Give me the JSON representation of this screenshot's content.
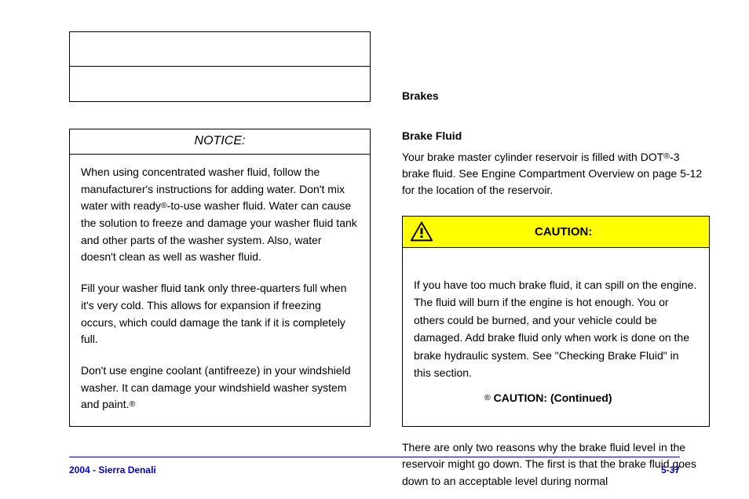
{
  "leftColumn": {
    "noticeHeader": "NOTICE:",
    "noticePara1_pre": "When using concentrated washer fluid, follow the manufacturer's instructions for adding water.\nDon't mix water with ready",
    "noticePara1_mid": "-",
    "noticePara1_post": "to",
    "noticePara1_after": "-",
    "noticePara1_rest": "use washer fluid.\nWater can cause the solution to freeze and damage your washer fluid tank and other parts of the washer system. Also, water doesn't clean as well as washer fluid.",
    "noticePara2": "Fill your washer fluid tank only three-quarters full when it's very cold. This allows for expansion if freezing occurs, which could damage the tank if it is completely full.",
    "noticePara3_pre": "Don't use engine coolant (antifreeze) in your windshield washer. It can damage your windshield washer system and paint."
  },
  "rightColumn": {
    "header": "Brakes",
    "subheader": "Brake Fluid",
    "para1_pre": "Your brake master cylinder reservoir is filled with DOT",
    "para1_mid": "-",
    "para1_post": "3 brake fluid. See ",
    "para1_link": "Engine Compartment Overview",
    "para1_after": " on page 5-12 for the location of the reservoir.",
    "caution": {
      "title": "CAUTION:",
      "body1": "If you have too much brake fluid, it can spill on the engine. The fluid will burn if the engine is hot enough. You or others could be burned, and your vehicle could be damaged. Add brake fluid only when work is done on the brake hydraulic system. See \"Checking Brake Fluid\" in this section.",
      "body2": "CAUTION: (Continued)"
    },
    "trail": "There are only two reasons why the brake fluid level in the reservoir might go down. The first is that the brake fluid goes down to an acceptable level during normal"
  },
  "footer": {
    "left": "2004 - Sierra Denali",
    "mid": "",
    "right": "5-37"
  }
}
